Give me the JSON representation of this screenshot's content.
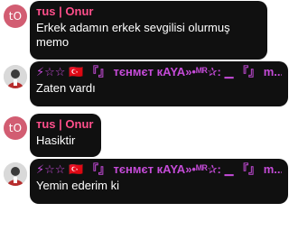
{
  "messages": [
    {
      "avatar": "tO",
      "name": "тus | Onur",
      "text": "Erkek adamın erkek sevgilisi olurmuş memo"
    },
    {
      "avatar": "",
      "name": "⚡☆☆ 🇹🇷 『』 тєнмєт кAYA»•ᴹᴿ✰: ▁ 『』 m...",
      "text": "Zaten vardı"
    },
    {
      "avatar": "tO",
      "name": "тus | Onur",
      "text": "Hasiktir"
    },
    {
      "avatar": "",
      "name": "⚡☆☆ 🇹🇷 『』 тєнмєт кAYA»•ᴹᴿ✰: ▁ 『』 m...",
      "text": "Yemin ederim ki"
    }
  ],
  "colors": {
    "bubble": "#101010",
    "name_pink": "#ff4f8b",
    "name_purple": "#c54bd8",
    "avatar_bg": "#d25d72"
  }
}
